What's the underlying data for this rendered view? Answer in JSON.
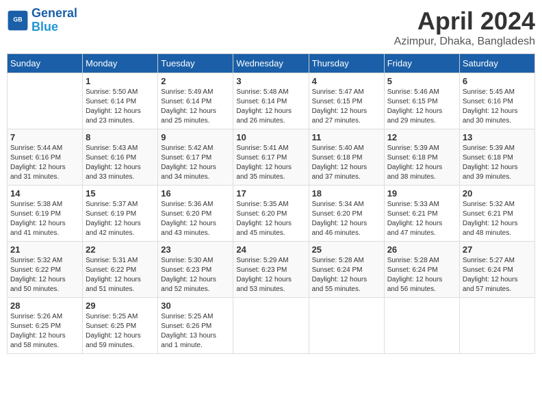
{
  "header": {
    "logo_line1": "General",
    "logo_line2": "Blue",
    "month_title": "April 2024",
    "subtitle": "Azimpur, Dhaka, Bangladesh"
  },
  "days_of_week": [
    "Sunday",
    "Monday",
    "Tuesday",
    "Wednesday",
    "Thursday",
    "Friday",
    "Saturday"
  ],
  "weeks": [
    [
      {
        "day": "",
        "info": ""
      },
      {
        "day": "1",
        "info": "Sunrise: 5:50 AM\nSunset: 6:14 PM\nDaylight: 12 hours\nand 23 minutes."
      },
      {
        "day": "2",
        "info": "Sunrise: 5:49 AM\nSunset: 6:14 PM\nDaylight: 12 hours\nand 25 minutes."
      },
      {
        "day": "3",
        "info": "Sunrise: 5:48 AM\nSunset: 6:14 PM\nDaylight: 12 hours\nand 26 minutes."
      },
      {
        "day": "4",
        "info": "Sunrise: 5:47 AM\nSunset: 6:15 PM\nDaylight: 12 hours\nand 27 minutes."
      },
      {
        "day": "5",
        "info": "Sunrise: 5:46 AM\nSunset: 6:15 PM\nDaylight: 12 hours\nand 29 minutes."
      },
      {
        "day": "6",
        "info": "Sunrise: 5:45 AM\nSunset: 6:16 PM\nDaylight: 12 hours\nand 30 minutes."
      }
    ],
    [
      {
        "day": "7",
        "info": "Sunrise: 5:44 AM\nSunset: 6:16 PM\nDaylight: 12 hours\nand 31 minutes."
      },
      {
        "day": "8",
        "info": "Sunrise: 5:43 AM\nSunset: 6:16 PM\nDaylight: 12 hours\nand 33 minutes."
      },
      {
        "day": "9",
        "info": "Sunrise: 5:42 AM\nSunset: 6:17 PM\nDaylight: 12 hours\nand 34 minutes."
      },
      {
        "day": "10",
        "info": "Sunrise: 5:41 AM\nSunset: 6:17 PM\nDaylight: 12 hours\nand 35 minutes."
      },
      {
        "day": "11",
        "info": "Sunrise: 5:40 AM\nSunset: 6:18 PM\nDaylight: 12 hours\nand 37 minutes."
      },
      {
        "day": "12",
        "info": "Sunrise: 5:39 AM\nSunset: 6:18 PM\nDaylight: 12 hours\nand 38 minutes."
      },
      {
        "day": "13",
        "info": "Sunrise: 5:39 AM\nSunset: 6:18 PM\nDaylight: 12 hours\nand 39 minutes."
      }
    ],
    [
      {
        "day": "14",
        "info": "Sunrise: 5:38 AM\nSunset: 6:19 PM\nDaylight: 12 hours\nand 41 minutes."
      },
      {
        "day": "15",
        "info": "Sunrise: 5:37 AM\nSunset: 6:19 PM\nDaylight: 12 hours\nand 42 minutes."
      },
      {
        "day": "16",
        "info": "Sunrise: 5:36 AM\nSunset: 6:20 PM\nDaylight: 12 hours\nand 43 minutes."
      },
      {
        "day": "17",
        "info": "Sunrise: 5:35 AM\nSunset: 6:20 PM\nDaylight: 12 hours\nand 45 minutes."
      },
      {
        "day": "18",
        "info": "Sunrise: 5:34 AM\nSunset: 6:20 PM\nDaylight: 12 hours\nand 46 minutes."
      },
      {
        "day": "19",
        "info": "Sunrise: 5:33 AM\nSunset: 6:21 PM\nDaylight: 12 hours\nand 47 minutes."
      },
      {
        "day": "20",
        "info": "Sunrise: 5:32 AM\nSunset: 6:21 PM\nDaylight: 12 hours\nand 48 minutes."
      }
    ],
    [
      {
        "day": "21",
        "info": "Sunrise: 5:32 AM\nSunset: 6:22 PM\nDaylight: 12 hours\nand 50 minutes."
      },
      {
        "day": "22",
        "info": "Sunrise: 5:31 AM\nSunset: 6:22 PM\nDaylight: 12 hours\nand 51 minutes."
      },
      {
        "day": "23",
        "info": "Sunrise: 5:30 AM\nSunset: 6:23 PM\nDaylight: 12 hours\nand 52 minutes."
      },
      {
        "day": "24",
        "info": "Sunrise: 5:29 AM\nSunset: 6:23 PM\nDaylight: 12 hours\nand 53 minutes."
      },
      {
        "day": "25",
        "info": "Sunrise: 5:28 AM\nSunset: 6:24 PM\nDaylight: 12 hours\nand 55 minutes."
      },
      {
        "day": "26",
        "info": "Sunrise: 5:28 AM\nSunset: 6:24 PM\nDaylight: 12 hours\nand 56 minutes."
      },
      {
        "day": "27",
        "info": "Sunrise: 5:27 AM\nSunset: 6:24 PM\nDaylight: 12 hours\nand 57 minutes."
      }
    ],
    [
      {
        "day": "28",
        "info": "Sunrise: 5:26 AM\nSunset: 6:25 PM\nDaylight: 12 hours\nand 58 minutes."
      },
      {
        "day": "29",
        "info": "Sunrise: 5:25 AM\nSunset: 6:25 PM\nDaylight: 12 hours\nand 59 minutes."
      },
      {
        "day": "30",
        "info": "Sunrise: 5:25 AM\nSunset: 6:26 PM\nDaylight: 13 hours\nand 1 minute."
      },
      {
        "day": "",
        "info": ""
      },
      {
        "day": "",
        "info": ""
      },
      {
        "day": "",
        "info": ""
      },
      {
        "day": "",
        "info": ""
      }
    ]
  ]
}
